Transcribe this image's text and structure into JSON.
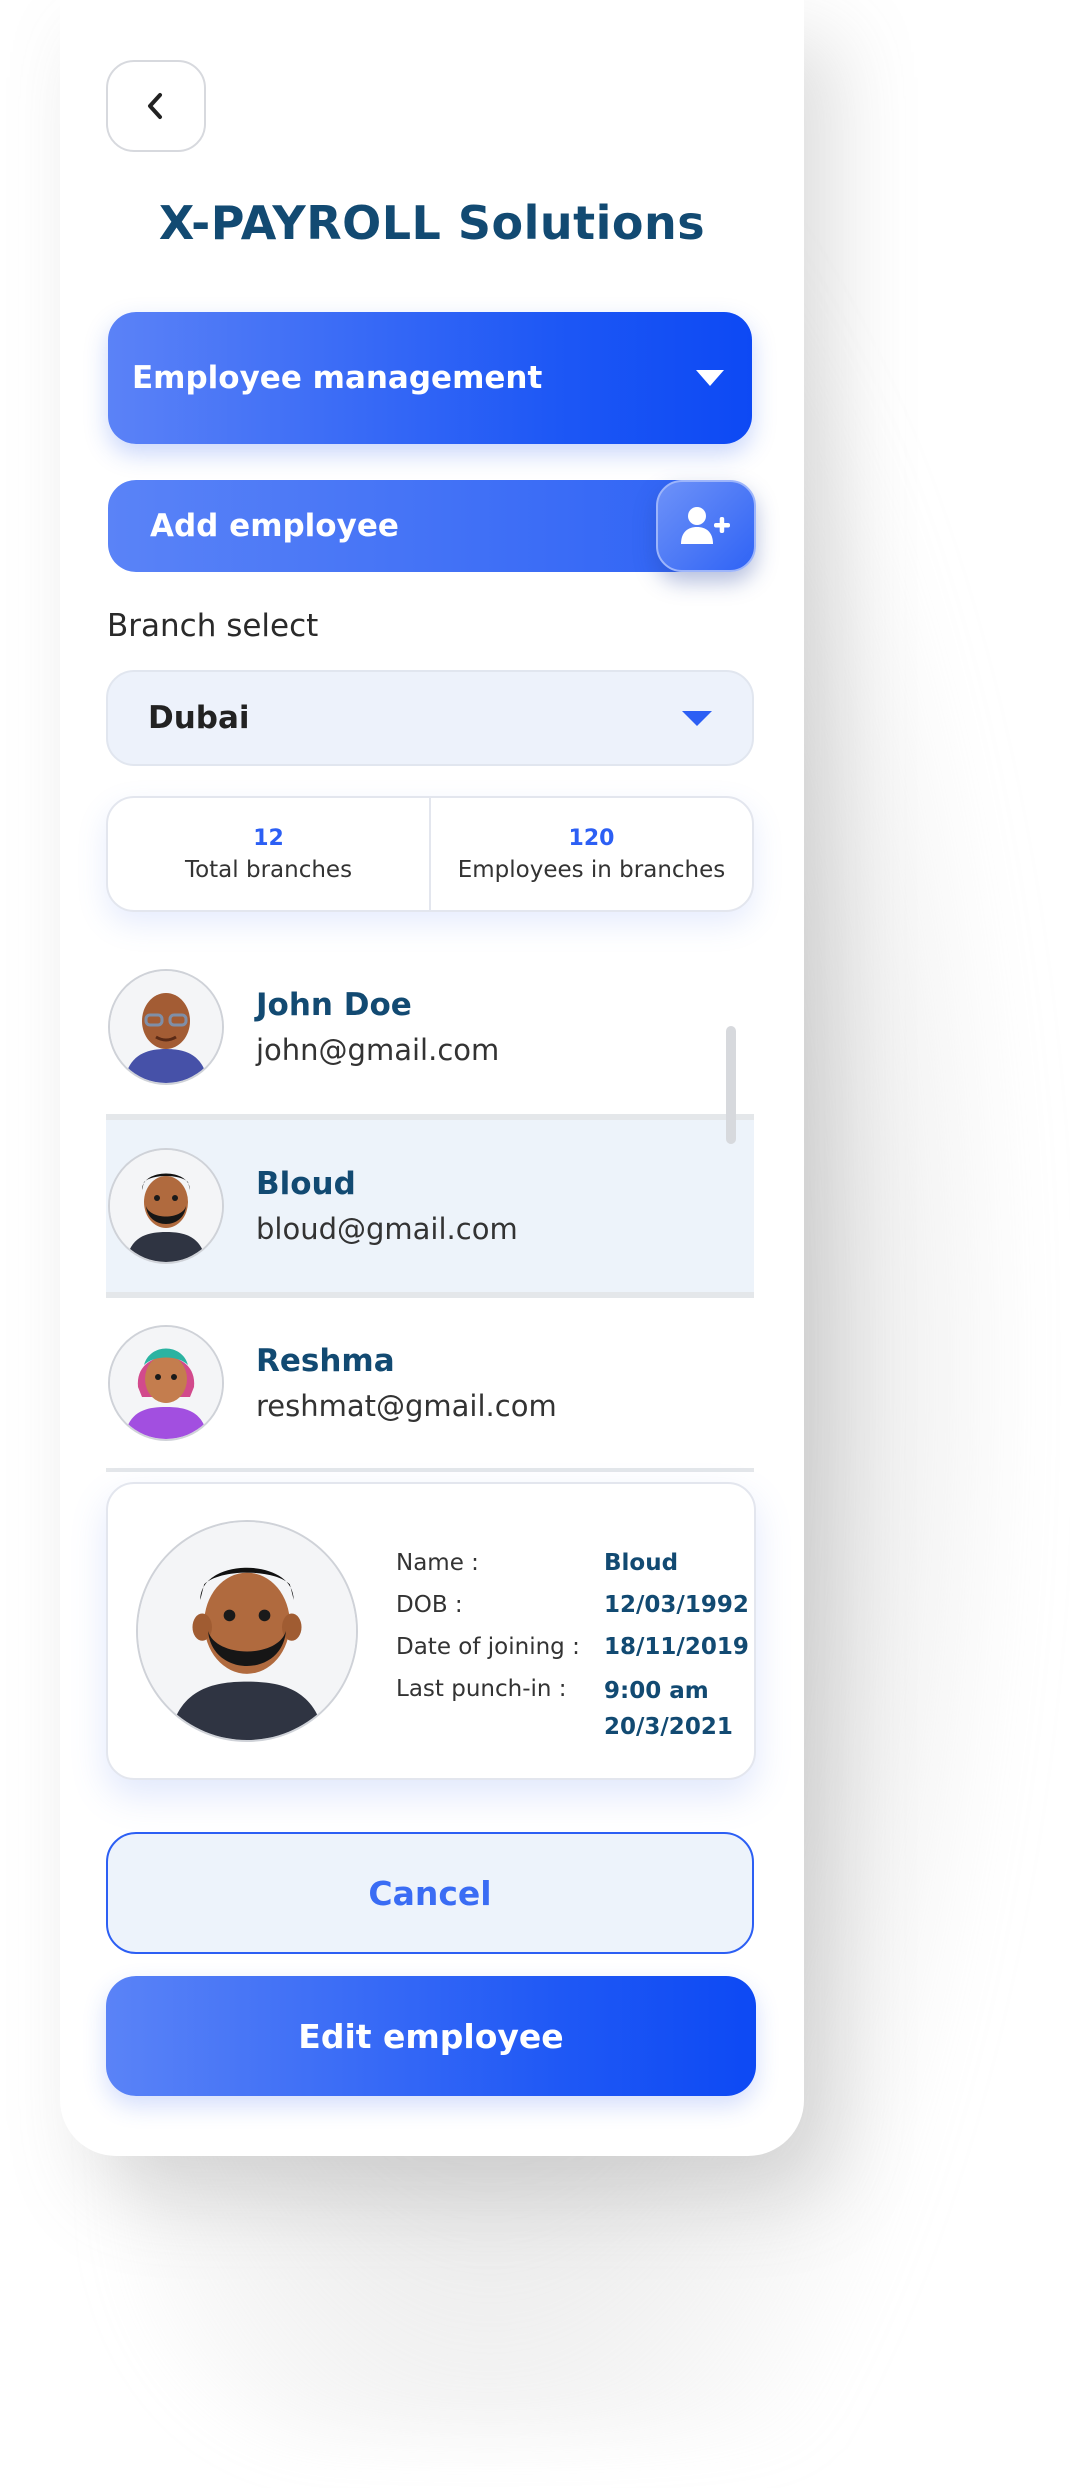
{
  "app": {
    "title": "X-PAYROLL Solutions"
  },
  "header": {
    "back_icon": "chevron-left-icon"
  },
  "menu": {
    "selected": "Employee management",
    "caret_icon": "caret-down-icon"
  },
  "add_employee": {
    "label": "Add employee",
    "icon": "add-user-icon"
  },
  "branch": {
    "label": "Branch select",
    "value": "Dubai"
  },
  "stats": [
    {
      "value": "12",
      "label": "Total branches"
    },
    {
      "value": "120",
      "label": "Employees in branches"
    }
  ],
  "employees": [
    {
      "name": "John Doe",
      "email": "john@gmail.com",
      "selected": false
    },
    {
      "name": "Bloud",
      "email": "bloud@gmail.com",
      "selected": true
    },
    {
      "name": "Reshma",
      "email": "reshmat@gmail.com",
      "selected": false
    }
  ],
  "detail": {
    "rows": [
      {
        "label": "Name :",
        "value": "Bloud"
      },
      {
        "label": "DOB :",
        "value": "12/03/1992"
      },
      {
        "label": "Date of joining :",
        "value": "18/11/2019"
      },
      {
        "label": "Last punch-in :",
        "value": "9:00 am"
      }
    ],
    "punch_date": "20/3/2021"
  },
  "actions": {
    "cancel": "Cancel",
    "edit": "Edit employee"
  },
  "colors": {
    "primary": "#2C5FF4",
    "title": "#124A72",
    "selected_row": "#EDF3FA"
  }
}
